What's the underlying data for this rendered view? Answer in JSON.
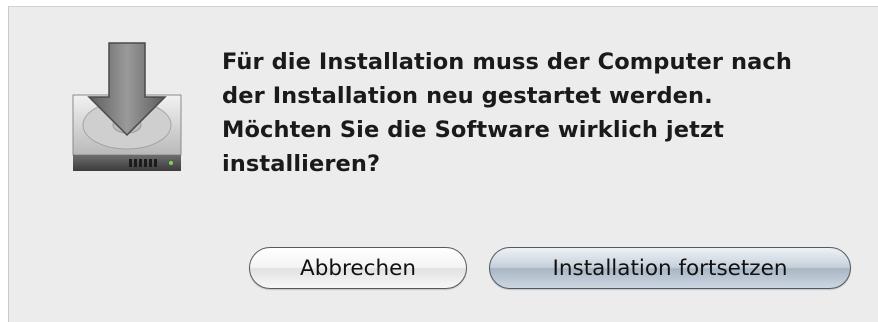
{
  "dialog": {
    "icon": "installer-disk-icon",
    "message_lines": [
      "Für die Installation muss der Computer nach",
      "der Installation neu gestartet werden.",
      "Möchten Sie die Software wirklich jetzt",
      "installieren?"
    ],
    "buttons": {
      "cancel_label": "Abbrechen",
      "continue_label": "Installation fortsetzen"
    }
  },
  "colors": {
    "dialog_background": "#ececec",
    "default_button": "#b4c0cc"
  }
}
